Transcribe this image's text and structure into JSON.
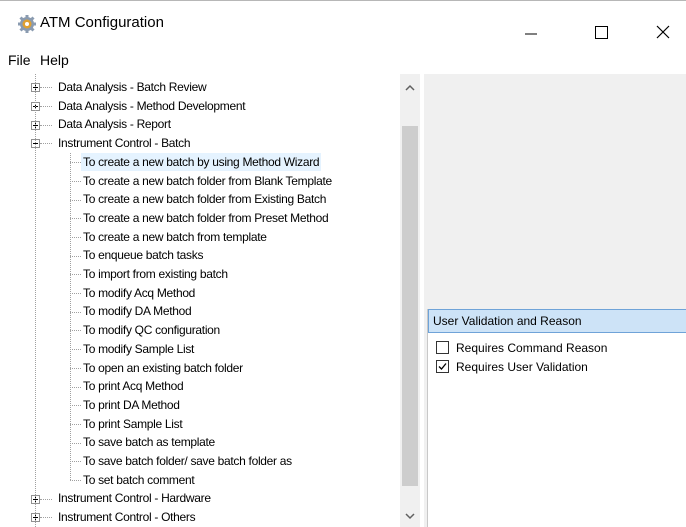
{
  "window": {
    "title": "ATM Configuration",
    "app_icon": "gear-icon"
  },
  "menu": {
    "file": "File",
    "help": "Help"
  },
  "tree": {
    "selected_item": "To create a new batch by using Method Wizard",
    "rows": [
      {
        "label": "Data Analysis - Batch Review",
        "level": 0,
        "expanded": false
      },
      {
        "label": "Data Analysis - Method Development",
        "level": 0,
        "expanded": false
      },
      {
        "label": "Data Analysis - Report",
        "level": 0,
        "expanded": false
      },
      {
        "label": "Instrument Control - Batch",
        "level": 0,
        "expanded": true
      },
      {
        "label": "To create a new batch by using Method Wizard",
        "level": 1
      },
      {
        "label": "To create a new batch folder from Blank Template",
        "level": 1
      },
      {
        "label": "To create a new batch folder from Existing Batch",
        "level": 1
      },
      {
        "label": "To create a new batch folder from Preset Method",
        "level": 1
      },
      {
        "label": "To create a new batch from template",
        "level": 1
      },
      {
        "label": "To enqueue batch tasks",
        "level": 1
      },
      {
        "label": "To import from existing batch",
        "level": 1
      },
      {
        "label": "To modify Acq Method",
        "level": 1
      },
      {
        "label": "To modify DA Method",
        "level": 1
      },
      {
        "label": "To modify QC configuration",
        "level": 1
      },
      {
        "label": "To modify Sample List",
        "level": 1
      },
      {
        "label": "To open an existing batch folder",
        "level": 1
      },
      {
        "label": "To print Acq Method",
        "level": 1
      },
      {
        "label": "To print DA Method",
        "level": 1
      },
      {
        "label": "To print Sample List",
        "level": 1
      },
      {
        "label": "To save batch as template",
        "level": 1
      },
      {
        "label": "To save batch folder/ save batch folder as",
        "level": 1
      },
      {
        "label": "To set batch comment",
        "level": 1
      },
      {
        "label": "Instrument Control - Hardware",
        "level": 0,
        "expanded": false
      },
      {
        "label": "Instrument Control - Others",
        "level": 0,
        "expanded": false
      }
    ]
  },
  "validation": {
    "header": "User Validation and Reason",
    "options": [
      {
        "label": "Requires Command Reason",
        "checked": false
      },
      {
        "label": "Requires User Validation",
        "checked": true
      }
    ]
  },
  "colors": {
    "selection": "#e5f3ff",
    "header_bg": "#cde3f7",
    "header_border": "#6fa3d8"
  }
}
